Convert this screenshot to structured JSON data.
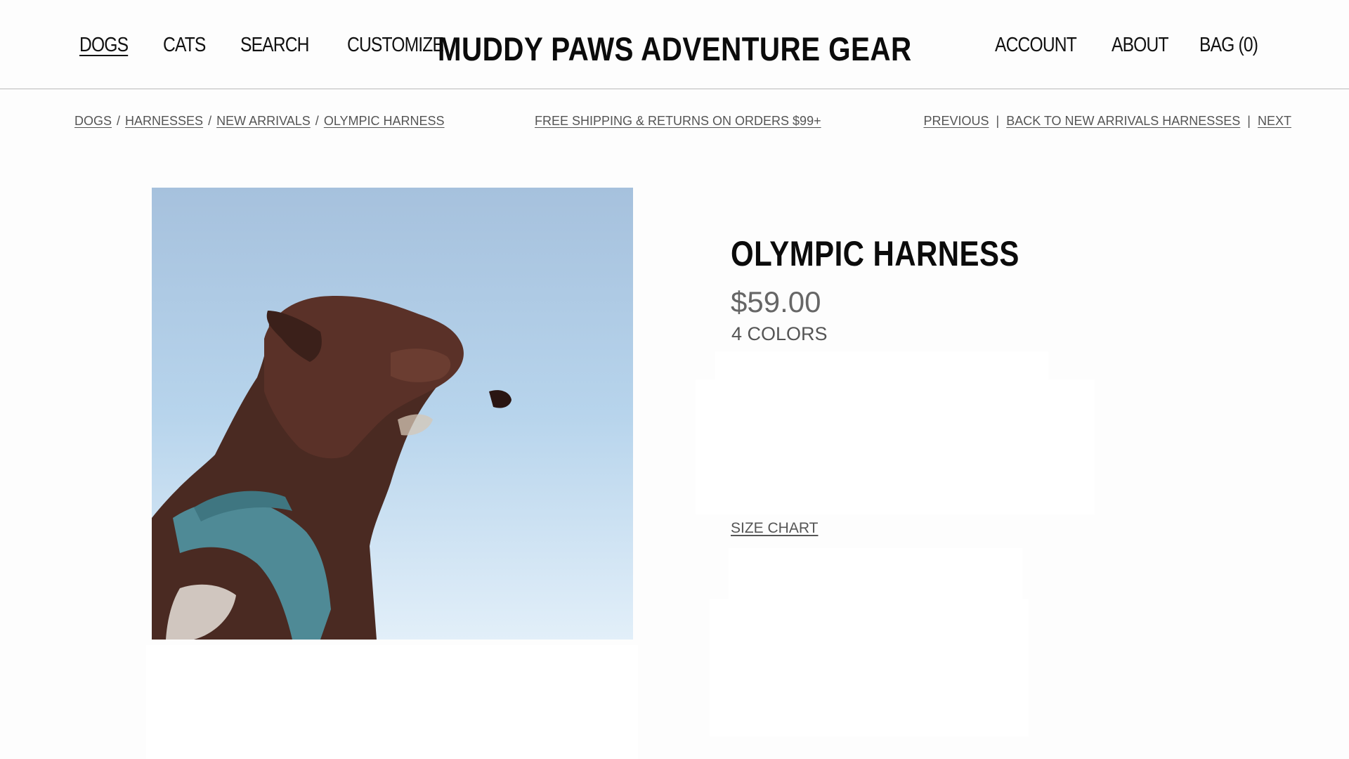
{
  "header": {
    "nav_left": [
      "DOGS",
      "CATS",
      "SEARCH",
      "CUSTOMIZE"
    ],
    "brand": "MUDDY PAWS ADVENTURE GEAR",
    "nav_right": [
      "ACCOUNT",
      "ABOUT",
      "BAG (0)"
    ]
  },
  "breadcrumb": {
    "items": [
      "DOGS",
      "HARNESSES",
      "NEW ARRIVALS",
      "OLYMPIC HARNESS"
    ],
    "separator": "/"
  },
  "promo": "FREE SHIPPING & RETURNS ON ORDERS $99+",
  "pager": {
    "previous": "PREVIOUS",
    "sep1": "|",
    "back": "BACK TO NEW ARRIVALS HARNESSES",
    "sep2": "|",
    "next": "NEXT"
  },
  "product": {
    "title": "OLYMPIC HARNESS",
    "price": "$59.00",
    "colors": "4 COLORS",
    "size_chart": "SIZE CHART"
  },
  "colors": {
    "text": "#111111",
    "muted": "#555555",
    "harness": "#4f8a96",
    "dog_fur": "#4a2a22"
  }
}
